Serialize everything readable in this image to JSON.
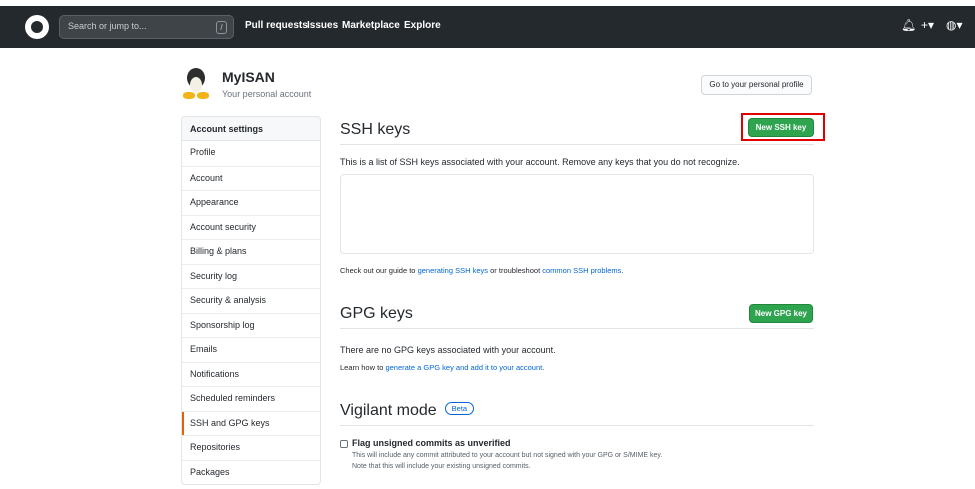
{
  "header": {
    "search_placeholder": "Search or jump to...",
    "search_key": "/",
    "nav": [
      "Pull requests",
      "Issues",
      "Marketplace",
      "Explore"
    ],
    "icons": [
      "bell-icon",
      "plus-icon",
      "avatar-icon"
    ]
  },
  "user": {
    "name": "MyISAN",
    "subtitle": "Your personal account",
    "profile_button": "Go to your personal profile"
  },
  "sidebar": {
    "header": "Account settings",
    "items": [
      "Profile",
      "Account",
      "Appearance",
      "Account security",
      "Billing & plans",
      "Security log",
      "Security & analysis",
      "Sponsorship log",
      "Emails",
      "Notifications",
      "Scheduled reminders",
      "SSH and GPG keys",
      "Repositories",
      "Packages"
    ],
    "selected": "SSH and GPG keys"
  },
  "ssh": {
    "title": "SSH keys",
    "new_button": "New SSH key",
    "description": "This is a list of SSH keys associated with your account. Remove any keys that you do not recognize.",
    "guide_prefix": "Check out our guide to ",
    "guide_link1": "generating SSH keys",
    "guide_mid": " or troubleshoot ",
    "guide_link2": "common SSH problems",
    "guide_suffix": "."
  },
  "gpg": {
    "title": "GPG keys",
    "new_button": "New GPG key",
    "empty": "There are no GPG keys associated with your account.",
    "learn_prefix": "Learn how to ",
    "learn_link": "generate a GPG key and add it to your account",
    "learn_suffix": "."
  },
  "vigilant": {
    "title": "Vigilant mode",
    "badge": "Beta",
    "checkbox_label": "Flag unsigned commits as unverified",
    "desc_line1": "This will include any commit attributed to your account but not signed with your GPG or S/MIME key.",
    "desc_line2": "Note that this will include your existing unsigned commits."
  },
  "colors": {
    "header_bg": "#24292e",
    "primary_green": "#2ea44f",
    "link_blue": "#0366d6",
    "highlight_red": "#e00000",
    "selected_accent": "#e36209"
  }
}
